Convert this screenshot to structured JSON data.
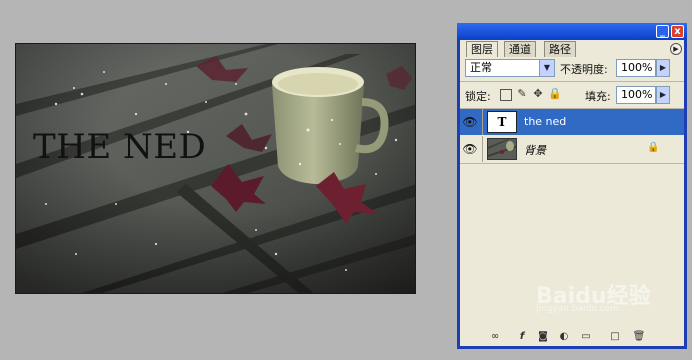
{
  "canvas": {
    "overlay_text": "THE NED"
  },
  "panel": {
    "tabs": [
      "图层",
      "通道",
      "路径"
    ],
    "active_tab_index": 0,
    "blend_mode": "正常",
    "opacity_label": "不透明度:",
    "opacity_value": "100%",
    "lock_label": "锁定:",
    "fill_label": "填充:",
    "fill_value": "100%",
    "layers": [
      {
        "name": "the ned",
        "type": "text",
        "selected": true,
        "visible": true
      },
      {
        "name": "背景",
        "type": "image",
        "selected": false,
        "visible": true,
        "locked": true
      }
    ],
    "minimize_glyph": "_",
    "close_glyph": "x",
    "text_thumb_glyph": "T"
  },
  "watermark": {
    "text": "Baidu经验",
    "sub": "jingyan.baidu.com"
  },
  "icons": {
    "eye": "eye-icon",
    "lock": "lock-icon",
    "link": "link-icon",
    "fx": "fx-icon",
    "mask": "mask-icon",
    "adjust": "adjustment-icon",
    "folder": "folder-icon",
    "new": "new-layer-icon",
    "trash": "trash-icon"
  },
  "colors": {
    "titlebar": "#0a3fc9",
    "selected_layer": "#316ac5",
    "panel_bg": "#ece9d8"
  }
}
